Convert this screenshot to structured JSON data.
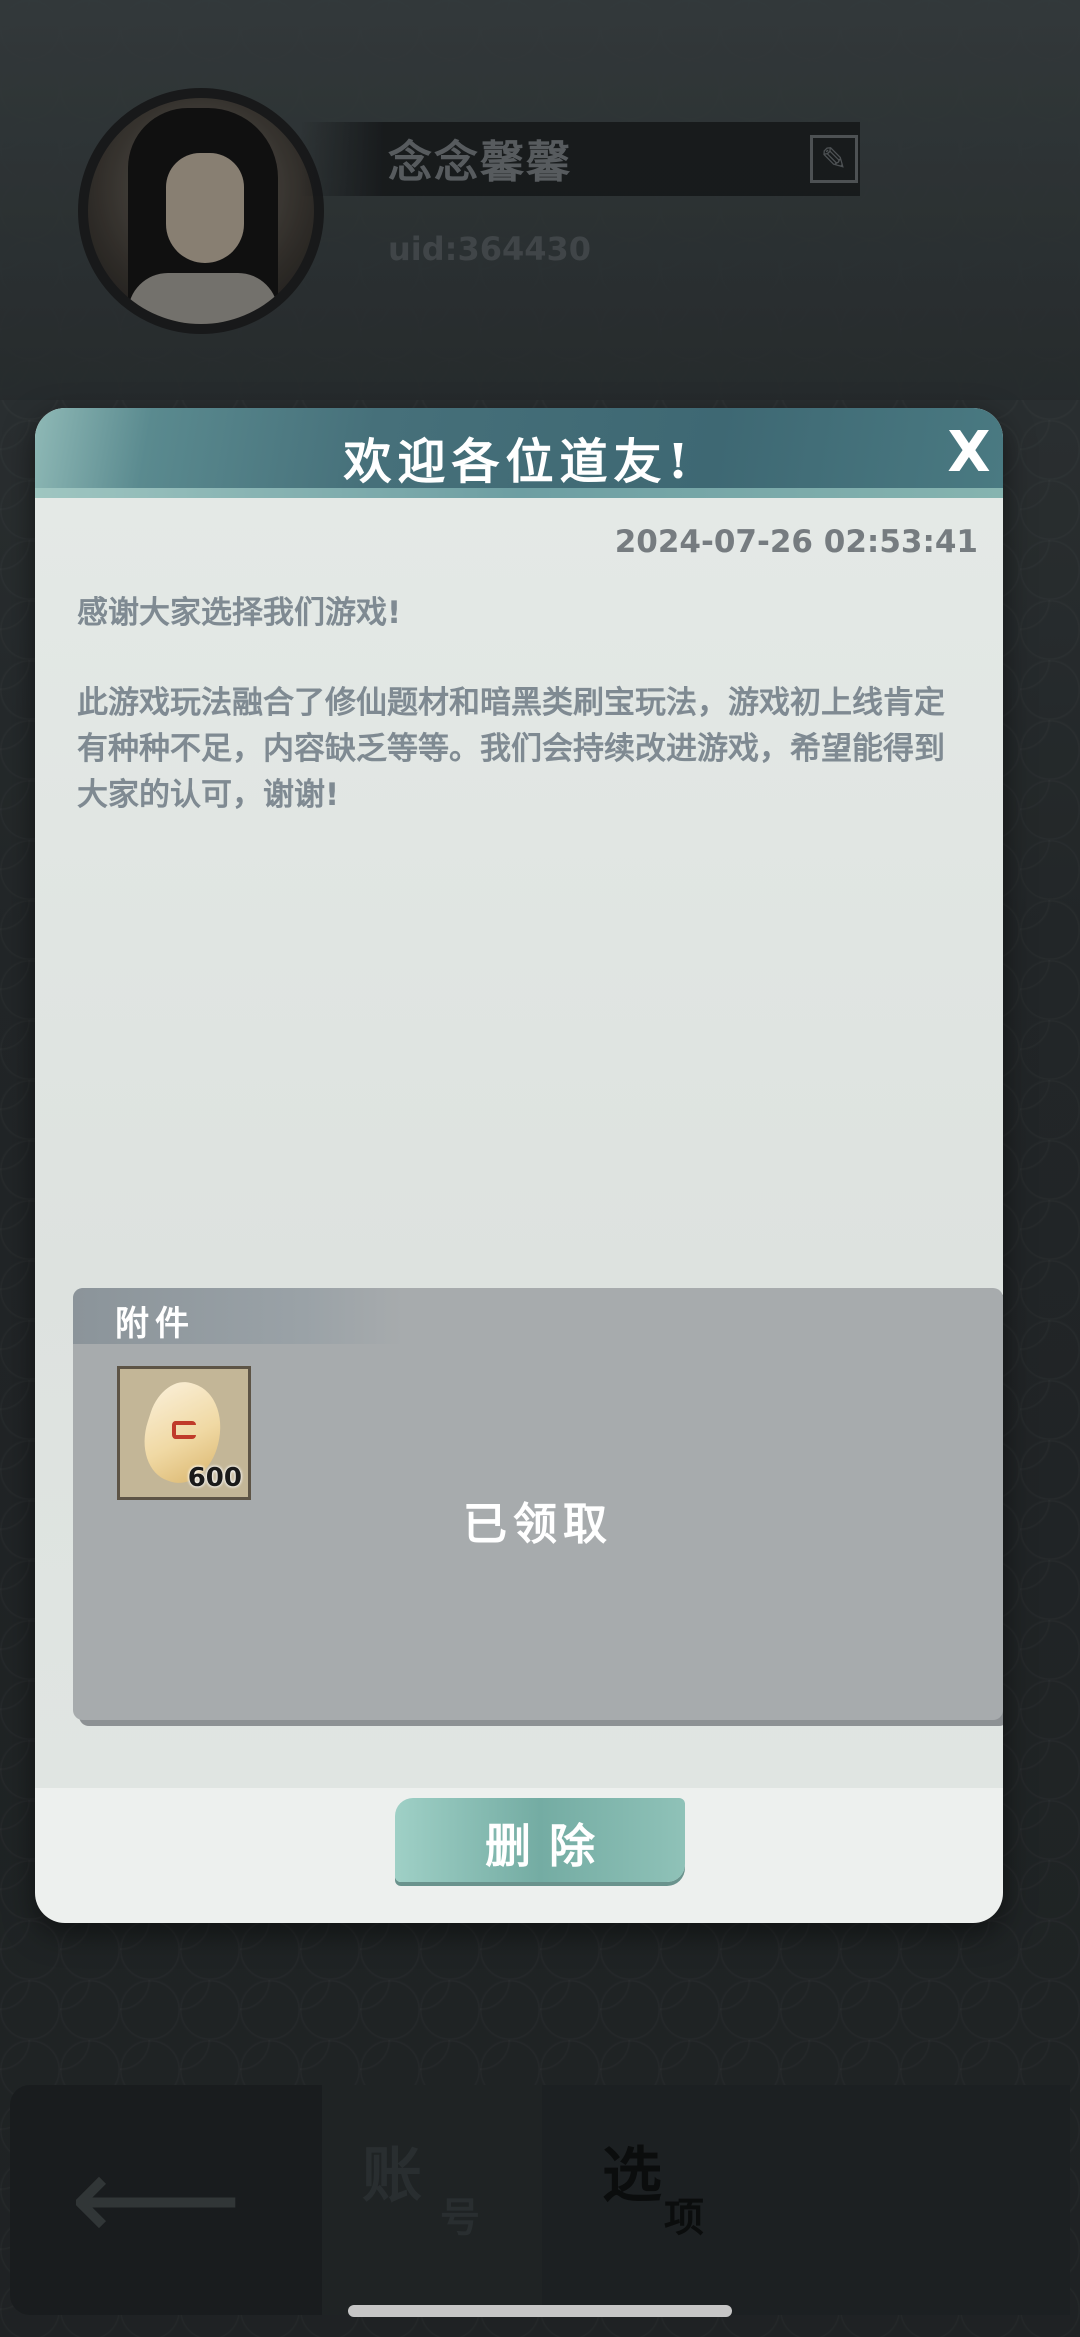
{
  "profile": {
    "username": "念念馨馨",
    "uid": "uid:364430",
    "edit_icon": "brush-edit-icon"
  },
  "dialog": {
    "title": "欢迎各位道友!",
    "close_glyph": "X",
    "timestamp": "2024-07-26 02:53:41",
    "paragraphs": [
      "感谢大家选择我们游戏!",
      "此游戏玩法融合了修仙题材和暗黑类刷宝玩法，游戏初上线肯定有种种不足，内容缺乏等等。我们会持续改进游戏，希望能得到大家的认可，谢谢!"
    ],
    "attachment": {
      "label": "附件",
      "item": {
        "icon": "spirit-stone-icon",
        "count": "600"
      },
      "status": "已领取"
    },
    "delete_label": "删除"
  },
  "bottom_nav": {
    "back_icon": "back-arrow-icon",
    "account_tab": {
      "main": "账",
      "sub": "号"
    },
    "options_tab": {
      "main": "选",
      "sub": "项"
    }
  }
}
